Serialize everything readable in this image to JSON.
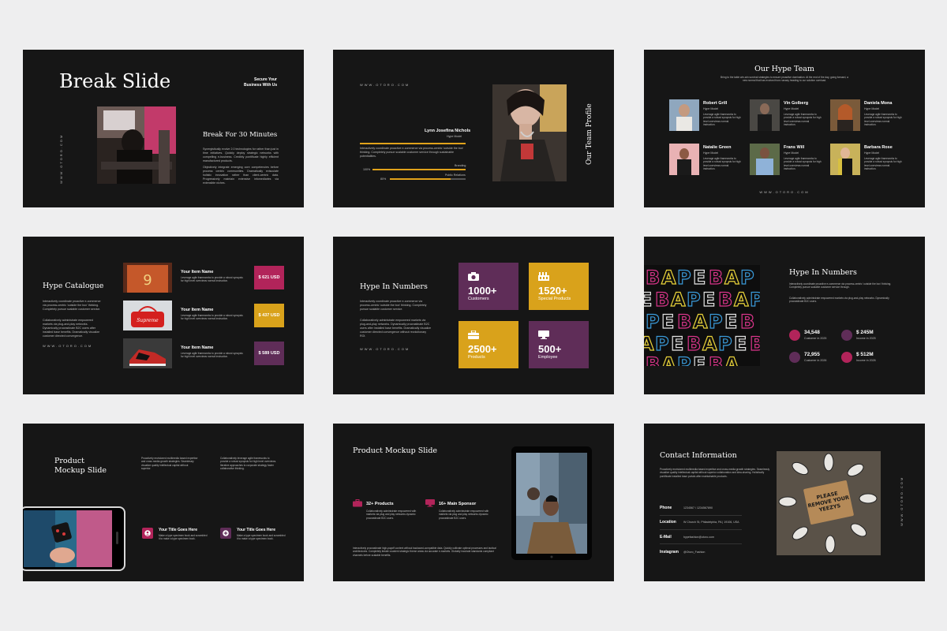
{
  "brand_colors": {
    "purple": "#5f2d58",
    "gold": "#d9a21b",
    "magenta": "#b2245a",
    "dark": "#161616"
  },
  "s1": {
    "title": "Break Slide",
    "secure": "Secure Your",
    "business": "Business With Us",
    "vertical_url": "WWW.OTORO.COM",
    "subtitle": "Break For 30 Minutes",
    "para1": "Synergistically evolve 2.0 technologies for rather than just in time initiatives. Quickly deploy strategic networks with compelling e-business. Credibly pontificate highly efficient manufactured products.",
    "para2": "Objectively integrate emerging core competencies before process centric communities. Dramatically evisculate holistic innovation rather than client-centric data. Progressively maintain extensive infomediaries via extensible niches."
  },
  "s2": {
    "url": "WWW.OTORO.COM",
    "name": "Lynn Josefina Nichols",
    "role": "Hype Model",
    "desc": "Interactively coordinate proactive e-commerce via process-centric 'outside the box' thinking. Completely pursue scalable customer service through sustainable potentialities.",
    "skill1_label": "Branding",
    "skill1_pct": "100%",
    "skill1_value": 1.0,
    "skill2_label": "Public Relations",
    "skill2_pct": "80%",
    "skill2_value": 0.8,
    "vertical_title": "Our Team Profile"
  },
  "s3": {
    "title": "Our Hype Team",
    "intro": "Bring to the table win-win survival strategies to ensure proactive domination. At the end of the day, going forward, a new normal that has evolved from runway heading to our solution overload.",
    "members": [
      {
        "name": "Robert Grill",
        "role": "Hype Model",
        "desc": "Leverage agile frameworks to provide a robust synopsis for high level overviews normal instruction."
      },
      {
        "name": "Vin Golberg",
        "role": "Hype Model",
        "desc": "Leverage agile frameworks to provide a robust synopsis for high level overviews normal instruction."
      },
      {
        "name": "Daniela Mona",
        "role": "Hype Model",
        "desc": "Leverage agile frameworks to provide a robust synopsis for high level overviews normal instruction."
      },
      {
        "name": "Natalie Green",
        "role": "Hype Model",
        "desc": "Leverage agile frameworks to provide a robust synopsis for high level overviews normal instruction."
      },
      {
        "name": "Frans Will",
        "role": "Hype Model",
        "desc": "Leverage agile frameworks to provide a robust synopsis for high level overviews normal instruction."
      },
      {
        "name": "Barbara Rose",
        "role": "Hype Model",
        "desc": "Leverage agile frameworks to provide a robust synopsis for high level overviews normal instruction."
      }
    ],
    "url": "WWW.OTORO.COM"
  },
  "s4": {
    "title": "Hype Catalogue",
    "para1": "Interactively coordinate proactive e-commerce via process-centric 'outside the box' thinking. Completely pursue scalable customer service.",
    "para2": "Collaboratively administrate empowered markets via plug-and-play networks. Dynamically procrastinate B2C users after installed base benefits. Dramatically visualize customer directed convergence.",
    "url": "WWW.OTORO.COM",
    "items": [
      {
        "name": "Your Item Name",
        "desc": "Leverage agile frameworks to provide a robust synopsis for high level overviews normal instruction.",
        "price": "$ 621 USD"
      },
      {
        "name": "Your Item Name",
        "desc": "Leverage agile frameworks to provide a robust synopsis for high level overviews normal instruction.",
        "price": "$ 437 USD"
      },
      {
        "name": "Your Item Name",
        "desc": "Leverage agile frameworks to provide a robust synopsis for high level overviews normal instruction.",
        "price": "$ 589 USD"
      }
    ],
    "bag_text": "Supreme"
  },
  "s5": {
    "title": "Hype In Numbers",
    "para1": "Interactively coordinate proactive e-commerce via process-centric 'outside the box' thinking. Completely pursue scalable customer service.",
    "para2": "Collaboratively administrate empowered markets via plug-and-play networks. Dynamically procrastinate B2C users after installed base benefits. Dramatically visualize customer directed convergence without revolutionary ROI.",
    "url": "WWW.OTORO.COM",
    "tiles": [
      {
        "num": "1000+",
        "cap": "Customers",
        "icon": "camera-icon"
      },
      {
        "num": "1520+",
        "cap": "Special Products",
        "icon": "factory-icon"
      },
      {
        "num": "2500+",
        "cap": "Products",
        "icon": "briefcase-icon"
      },
      {
        "num": "500+",
        "cap": "Employee",
        "icon": "monitor-icon"
      }
    ]
  },
  "s6": {
    "title": "Hype In Numbers",
    "para1": "Interactively coordinate proactive e-commerce via process-centric 'outside the box' thinking. Completely pursue scalable customer service through.",
    "para2": "Collaboratively administrate empowered markets via plug-and-play networks. Dynamically procrastinate B2C users.",
    "stats": [
      {
        "value": "34,548",
        "cap": "Customer in 2025"
      },
      {
        "value": "$ 245M",
        "cap": "Income in 2025"
      },
      {
        "value": "72,955",
        "cap": "Customer in 2026"
      },
      {
        "value": "$ 512M",
        "cap": "Income in 2026"
      }
    ]
  },
  "s7": {
    "title1": "Product",
    "title2": "Mockup Slide",
    "col1": "Proactively envisioned multimedia based expertise and cross media growth strategies. Seamlessly visualize quality intellectual capital without superior.",
    "col2": "Collaboratively leverage agile frameworks to provide a robust synopsis for high level overviews. Iterative approaches to corporate strategy foster collaborative thinking.",
    "feat1_title": "Your Title Goes Here",
    "feat1_desc": "Make a type specimen book and scrambled it to make a type specimen book.",
    "feat2_title": "Your Title Goes Here",
    "feat2_desc": "Make a type specimen book and scrambled it to make a type specimen book."
  },
  "s8": {
    "title": "Product Mockup Slide",
    "stat1": "32+ Products",
    "stat1_desc": "Collaboratively administrate empowered with markets via plug and play networks dynamic procrastinate B2C users.",
    "stat2": "16+ Main Sponsor",
    "stat2_desc": "Collaboratively administrate empowered with markets via plug and play networks dynamic procrastinate B2C users.",
    "footer": "Interactively procrastinate high-payoff content without backward-compatible data. Quickly cultivate optimal processes and tactical architectures. Completely iterate covalent strategic theme areas via accurate e-markets. Globally incubate standards compliant channels before scalable benefits."
  },
  "s9": {
    "title": "Contact Information",
    "intro": "Proactively envisioned multimedia based expertise and cross-media growth strategies. Seamlessly visualize quality intellectual capital without superior collaboration and idea-sharing. Holistically pontificate installed base portals after maintainable products.",
    "rows": [
      {
        "label": "Phone",
        "value": "1234567 / 1234567890"
      },
      {
        "label": "Location",
        "value": "W Church St, Philadelphia, PA | 19106, USA"
      },
      {
        "label": "E-Mail",
        "value": "hypefashion@otoro.com"
      },
      {
        "label": "Instagram",
        "value": "@Otoro_Fashion"
      }
    ],
    "vertical_url": "WWW.OTORO.COM",
    "mat_text": "PLEASE REMOVE YOUR YEEZYS"
  }
}
